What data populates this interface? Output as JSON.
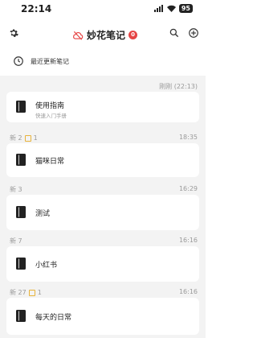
{
  "status_bar": {
    "time": "22:14",
    "battery": "95"
  },
  "header": {
    "title": "妙花笔记",
    "badge": "0"
  },
  "recent": {
    "label": "最近更新笔记"
  },
  "groups": [
    {
      "meta": "",
      "square_count": "",
      "time": "刚刚 (22:13)"
    },
    {
      "meta": "新 2",
      "square_count": "1",
      "time": "18:35"
    },
    {
      "meta": "新 3",
      "square_count": "",
      "time": "16:29"
    },
    {
      "meta": "新 7",
      "square_count": "",
      "time": "16:16"
    },
    {
      "meta": "新 27",
      "square_count": "1",
      "time": "16:16"
    }
  ],
  "notes": [
    {
      "title": "使用指南",
      "subtitle": "快速入门手册"
    },
    {
      "title": "猫咪日常",
      "subtitle": ""
    },
    {
      "title": "测试",
      "subtitle": ""
    },
    {
      "title": "小红书",
      "subtitle": ""
    },
    {
      "title": "每天的日常",
      "subtitle": ""
    }
  ],
  "icons": {
    "settings": "gear-icon",
    "cloud": "cloud-off-icon",
    "search": "search-icon",
    "add": "add-circle-icon",
    "recent": "clock-icon",
    "note": "notebook-icon"
  },
  "colors": {
    "accent": "#e64545",
    "background": "#f3f3f3",
    "card": "#ffffff",
    "square": "#e8b33a"
  }
}
